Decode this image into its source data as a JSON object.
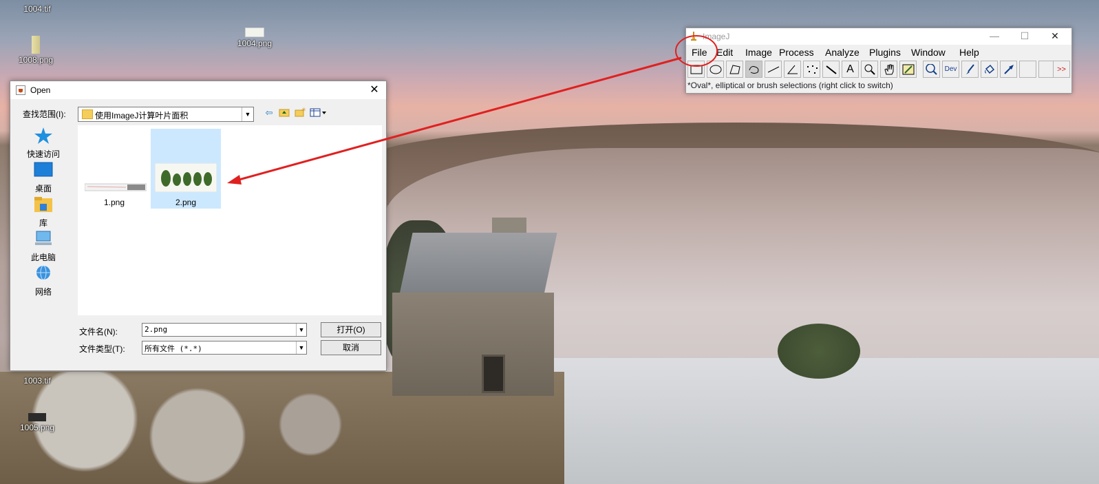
{
  "desktop": {
    "icons": [
      {
        "name": "1004.tif"
      },
      {
        "name": "1008.png"
      },
      {
        "name": "1004.png"
      },
      {
        "name": "1003.tif"
      },
      {
        "name": "1005.png"
      }
    ]
  },
  "imagej": {
    "title": "ImageJ",
    "controls": {
      "minimize": "—",
      "maximize": "☐",
      "close": "✕"
    },
    "menu": [
      "File",
      "Edit",
      "Image",
      "Process",
      "Analyze",
      "Plugins",
      "Window",
      "Help"
    ],
    "tools": [
      "rectangle",
      "oval",
      "polygon",
      "freehand",
      "straight-line",
      "angle",
      "multi-point",
      "wand",
      "text",
      "magnifier",
      "scroll",
      "color-picker",
      "zoom",
      "Dev",
      "brush",
      "flood-fill",
      "arrow",
      "",
      "",
      ">>"
    ],
    "status": "*Oval*, elliptical or brush selections (right click to switch)"
  },
  "dialog": {
    "title": "Open",
    "close": "✕",
    "look_in_label": "查找范围(I):",
    "look_in_value": "使用ImageJ计算叶片面积",
    "places": [
      "快速访问",
      "桌面",
      "库",
      "此电脑",
      "网络"
    ],
    "files": [
      {
        "name": "1.png",
        "selected": false
      },
      {
        "name": "2.png",
        "selected": true
      }
    ],
    "filename_label": "文件名(N):",
    "filename_value": "2.png",
    "filetype_label": "文件类型(T):",
    "filetype_value": "所有文件 (*.*)",
    "open_button": "打开(O)",
    "cancel_button": "取消"
  },
  "colors": {
    "annotation": "#e02020",
    "selection": "#cce8ff"
  }
}
